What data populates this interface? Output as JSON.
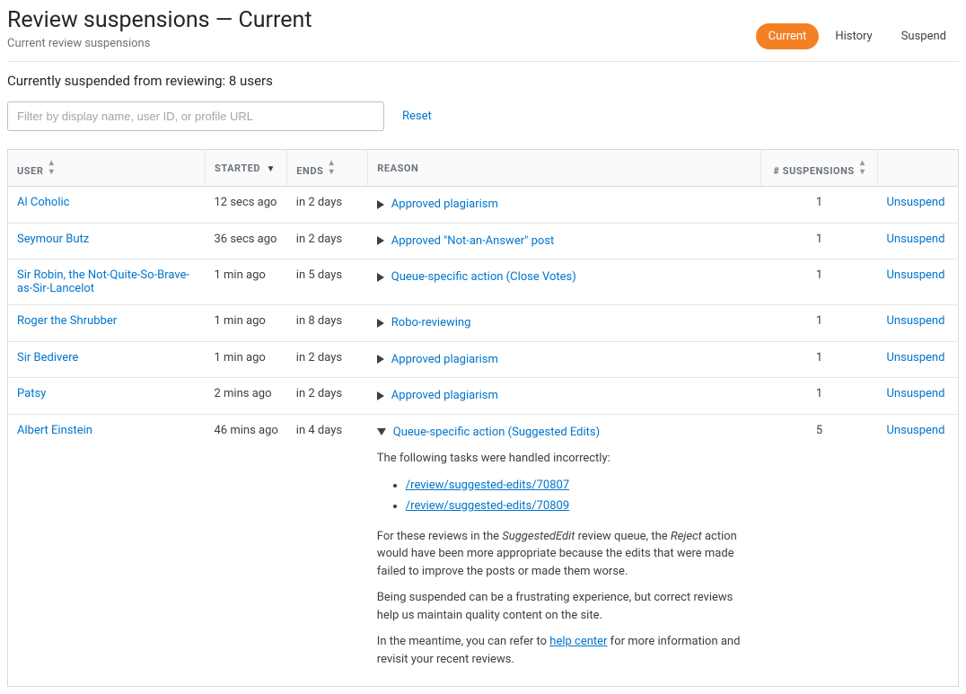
{
  "header": {
    "title": "Review suspensions — Current",
    "subtitle": "Current review suspensions"
  },
  "tabs": [
    {
      "label": "Current",
      "active": true
    },
    {
      "label": "History",
      "active": false
    },
    {
      "label": "Suspend",
      "active": false
    }
  ],
  "summary": "Currently suspended from reviewing: 8 users",
  "filter": {
    "placeholder": "Filter by display name, user ID, or profile URL",
    "reset": "Reset"
  },
  "columns": {
    "user": "User",
    "started": "Started",
    "ends": "Ends",
    "reason": "Reason",
    "suspensions": "# Suspensions"
  },
  "action_label": "Unsuspend",
  "rows": [
    {
      "user": "Al Coholic",
      "started": "12 secs ago",
      "ends": "in 2 days",
      "reason": "Approved plagiarism",
      "suspensions": "1",
      "expanded": false
    },
    {
      "user": "Seymour Butz",
      "started": "36 secs ago",
      "ends": "in 2 days",
      "reason": "Approved \"Not-an-Answer\" post",
      "suspensions": "1",
      "expanded": false
    },
    {
      "user": "Sir Robin, the Not-Quite-So-Brave-as-Sir-Lancelot",
      "started": "1 min ago",
      "ends": "in 5 days",
      "reason": "Queue-specific action (Close Votes)",
      "suspensions": "1",
      "expanded": false
    },
    {
      "user": "Roger the Shrubber",
      "started": "1 min ago",
      "ends": "in 8 days",
      "reason": "Robo-reviewing",
      "suspensions": "1",
      "expanded": false
    },
    {
      "user": "Sir Bedivere",
      "started": "1 min ago",
      "ends": "in 2 days",
      "reason": "Approved plagiarism",
      "suspensions": "1",
      "expanded": false
    },
    {
      "user": "Patsy",
      "started": "2 mins ago",
      "ends": "in 2 days",
      "reason": "Approved plagiarism",
      "suspensions": "1",
      "expanded": false
    },
    {
      "user": "Albert Einstein",
      "started": "46 mins ago",
      "ends": "in 4 days",
      "reason": "Queue-specific action (Suggested Edits)",
      "suspensions": "5",
      "expanded": true
    }
  ],
  "expanded_detail": {
    "intro": "The following tasks were handled incorrectly:",
    "links": [
      "/review/suggested-edits/70807",
      "/review/suggested-edits/70809"
    ],
    "para1_a": "For these reviews in the ",
    "para1_b": "SuggestedEdit",
    "para1_c": " review queue, the ",
    "para1_d": "Reject",
    "para1_e": " action would have been more appropriate because the edits that were made failed to improve the posts or made them worse.",
    "para2": "Being suspended can be a frustrating experience, but correct reviews help us maintain quality content on the site.",
    "para3_a": "In the meantime, you can refer to ",
    "para3_link": "help center",
    "para3_b": " for more information and revisit your recent reviews."
  }
}
